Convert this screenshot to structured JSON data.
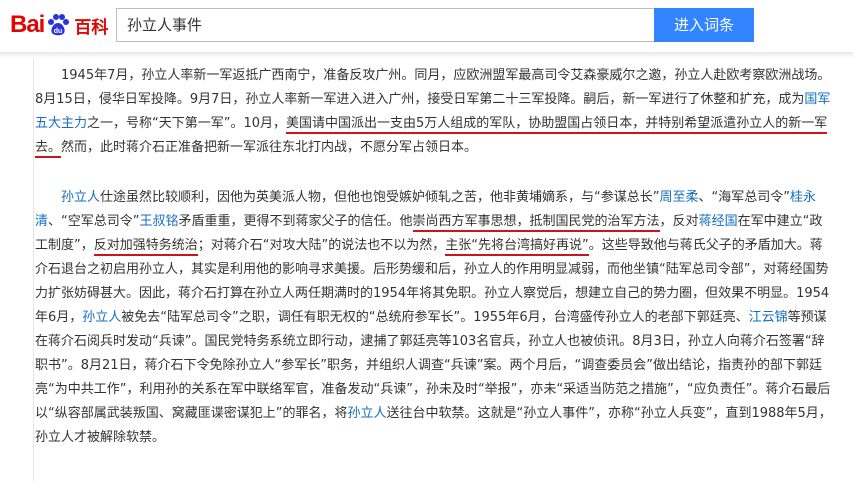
{
  "header": {
    "logo": {
      "bai": "Bai",
      "du": "du",
      "cn": "百科"
    },
    "search_value": "孙立人事件",
    "search_button": "进入词条"
  },
  "article": {
    "p1": [
      {
        "t": "1945年7月，孙立人率新一军返抵广西南宁，准备反攻广州。同月，应欧洲盟军最高司令艾森豪威尔之邀，孙立人赴欧考察欧洲战场。8月15日，侵华日军投降。9月7日，孙立人率新一军进入进入广州，接受日军第二十三军投降。嗣后，新一军进行了休整和扩充，成为"
      },
      {
        "t": "国军五大主力",
        "link": true
      },
      {
        "t": "之一，号称“天下第一军”。10月，"
      },
      {
        "t": "美国请中国派出一支由5万人组成的军队，协助盟国占领日本，并特别希望派遣孙立人的新一军去。",
        "hl": true
      },
      {
        "t": "然而，此时蒋介石正准备把新一军派往东北打内战，不愿分军占领日本。"
      }
    ],
    "p2": [
      {
        "t": "孙立人",
        "link": true
      },
      {
        "t": "仕途虽然比较顺利，因他为英美派人物，但他也饱受嫉妒倾轧之苦，他非黄埔嫡系，与“参谋总长”"
      },
      {
        "t": "周至柔",
        "link": true
      },
      {
        "t": "、“海军总司令”"
      },
      {
        "t": "桂永清",
        "link": true
      },
      {
        "t": "、“空军总司令”"
      },
      {
        "t": "王叔铭",
        "link": true
      },
      {
        "t": "矛盾重重，更得不到蒋家父子的信任。他"
      },
      {
        "t": "崇尚西方军事思想，抵制国民党的治军方法",
        "hl": true
      },
      {
        "t": "，反对"
      },
      {
        "t": "蒋经国",
        "link": true
      },
      {
        "t": "在军中建立“政工制度”，"
      },
      {
        "t": "反对加强特务统治",
        "hl": true
      },
      {
        "t": "；对蒋介石“对攻大陆”的说法也不以为然，"
      },
      {
        "t": "主张“先将台湾搞好再说”",
        "hl": true
      },
      {
        "t": "。这些导致他与蒋氏父子的矛盾加大。蒋介石退台之初启用孙立人，其实是利用他的影响寻求美援。后形势缓和后，孙立人的作用明显减弱，而他坐镇“陆军总司令部”，对蒋经国势力扩张妨碍甚大。因此，蒋介石打算在孙立人两任期满时的1954年将其免职。孙立人察觉后，想建立自己的势力圈，但效果不明显。1954年6月，"
      },
      {
        "t": "孙立人",
        "link": true
      },
      {
        "t": "被免去“陆军总司令”之职，调任有职无权的“总统府参军长”。1955年6月，台湾盛传孙立人的老部下郭廷亮、"
      },
      {
        "t": "江云锦",
        "link": true
      },
      {
        "t": "等预谋在蒋介石阅兵时发动“兵谏”。国民党特务系统立即行动，逮捕了郭廷亮等103名官兵，孙立人也被侦讯。8月3日，孙立人向蒋介石签署“辞职书”。8月21日，蒋介石下令免除孙立人“参军长”职务，并组织人调查“兵谏”案。两个月后，“调查委员会”做出结论，指责孙的部下郭廷亮“为中共工作”，利用孙的关系在军中联络军官，准备发动“兵谏”，孙未及时“举报”，亦未“采适当防范之措施”，“应负责任”。蒋介石最后以“纵容部属武装叛国、窝藏匪谍密谋犯上”的罪名，将"
      },
      {
        "t": "孙立人",
        "link": true
      },
      {
        "t": "送往台中软禁。这就是“孙立人事件”，亦称“孙立人兵变”，直到1988年5月，孙立人才被解除软禁。"
      }
    ]
  }
}
